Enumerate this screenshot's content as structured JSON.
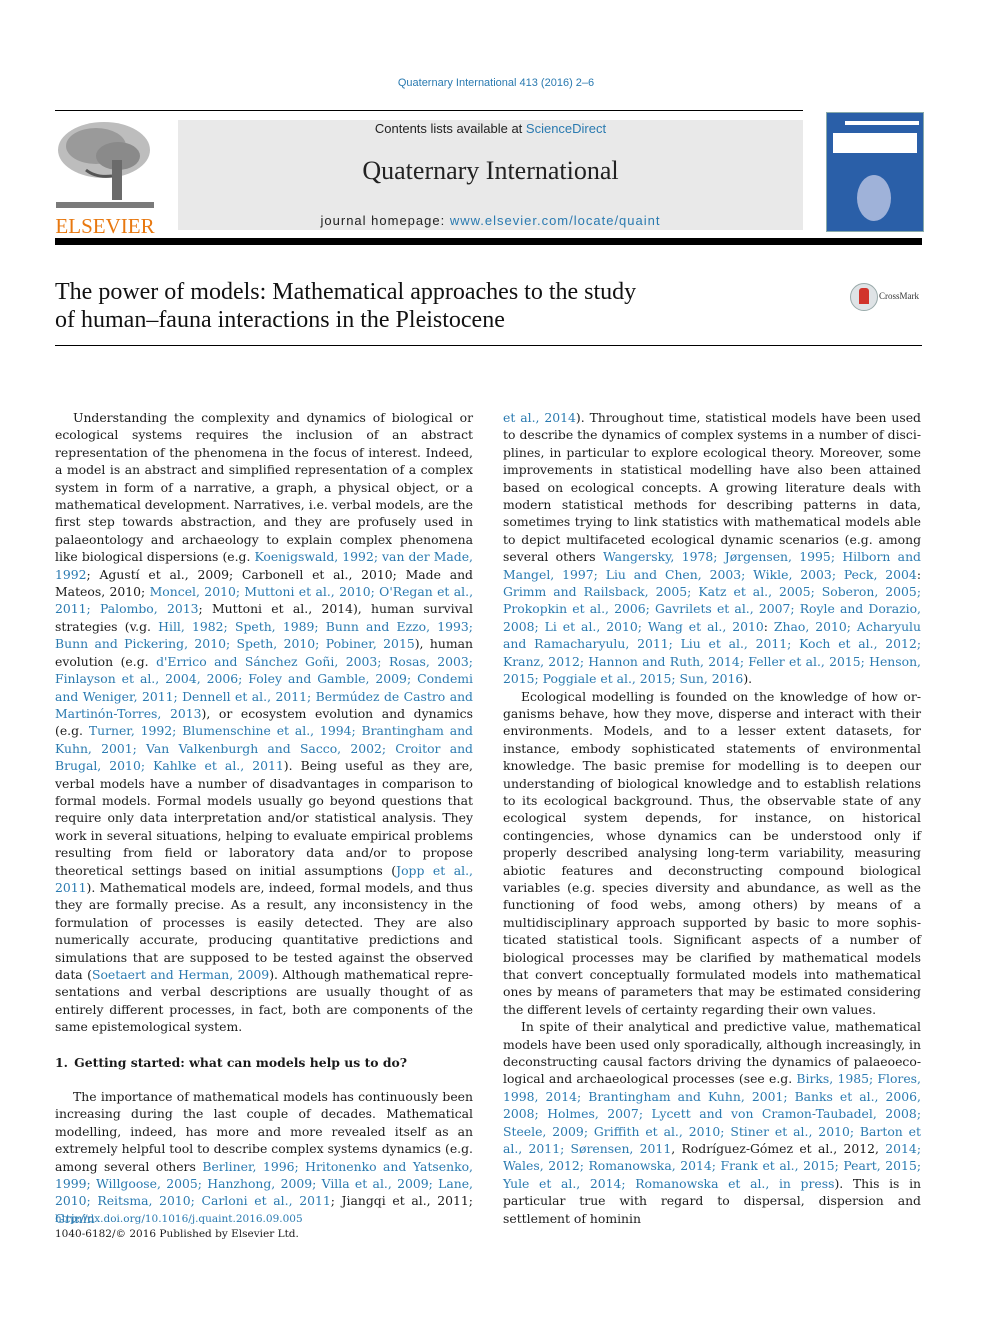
{
  "header": {
    "journal_reference": "Quaternary International 413 (2016) 2–6",
    "contents_prefix": "Contents lists available at ",
    "contents_link": "ScienceDirect",
    "journal_title": "Quaternary International",
    "homepage_prefix": "journal homepage: ",
    "homepage_link": "www.elsevier.com/locate/quaint",
    "publisher_logo_text": "ELSEVIER",
    "crossmark_label": "CrossMark"
  },
  "colors": {
    "link": "#2a7ab0",
    "elsevier_orange": "#e8780f",
    "masthead_bg": "#e9e9e9",
    "cover_blue": "#2a5fa8"
  },
  "article": {
    "title_line1": "The power of models: Mathematical approaches to the study",
    "title_line2": "of human–fauna interactions in the Pleistocene"
  },
  "left_column": {
    "p1": [
      {
        "t": "Understanding the complexity and dynamics of biological or ecological systems requires the inclusion of an abstract representa­tion of the phenomena in the focus of interest. Indeed, a model is an abstract and simplified representation of a complex system in form of a narrative, a graph, a physical object, or a mathematical devel­opment. Narratives, i.e. verbal models, are the first step towards abstraction, and they are profusely used in palaeontology and archaeology to explain complex phenomena like biological disper­sions (e.g. "
      },
      {
        "t": "Koenigswald, 1992; van der Made, 1992",
        "link": true
      },
      {
        "t": "; Agustí et al., 2009; Carbonell et al., 2010; Made and Mateos, 2010; "
      },
      {
        "t": "Moncel, 2010; Muttoni et al., 2010; O'Regan et al., 2011; Palombo, 2013",
        "link": true
      },
      {
        "t": "; Muttoni et al., 2014), human survival strategies (v.g. "
      },
      {
        "t": "Hill, 1982; Speth, 1989; Bunn and Ezzo, 1993; Bunn and Pickering, 2010; Speth, 2010; Pobiner, 2015",
        "link": true
      },
      {
        "t": "), human evolution (e.g. "
      },
      {
        "t": "d'Errico and Sánchez Goñi, 2003; Rosas, 2003; Finlayson et al., 2004, 2006; Foley and Gamble, 2009; Condemi and Weniger, 2011; Dennell et al., 2011; Bermúdez de Castro and Martinón-Torres, 2013",
        "link": true
      },
      {
        "t": "), or ecosystem evolution and dynamics (e.g. "
      },
      {
        "t": "Turner, 1992; Blumenschine et al., 1994; Brantingham and Kuhn, 2001; Van Valkenburgh and Sacco, 2002; Croitor and Brugal, 2010; Kahlke et al., 2011",
        "link": true
      },
      {
        "t": "). Being useful as they are, verbal models have a number of disadvantages in comparison to formal models. Formal models usually go beyond questions that require only data interpretation and/or statistical analysis. They work in several situations, helping to evaluate empirical problems resulting from field or laboratory data and/or to propose theoretical settings based on initial assump­tions ("
      },
      {
        "t": "Jopp et al., 2011",
        "link": true
      },
      {
        "t": "). Mathematical models are, indeed, formal models, and thus they are formally precise. As a result, any incon­sistency in the formulation of processes is easily detected. They are also numerically accurate, producing quantitative predictions and simulations that are supposed to be tested against the observed data ("
      },
      {
        "t": "Soetaert and Herman, 2009",
        "link": true
      },
      {
        "t": "). Although mathematical repre­sentations and verbal descriptions are usually thought of as entirely different processes, in fact, both are components of the same epis­temological system."
      }
    ],
    "section_heading": "1. Getting started: what can models help us to do?",
    "p2": [
      {
        "t": "The importance of mathematical models has continuously been increasing during the last couple of decades. Mathematical model­ling, indeed, has more and more revealed itself as an extremely helpful tool to describe complex systems dynamics (e.g. among several others "
      },
      {
        "t": "Berliner, 1996; Hritonenko and Yatsenko, 1999; Willgoose, 2005; Hanzhong, 2009; Villa et al., 2009; Lane, 2010; Reitsma, 2010; Carloni et al., 2011",
        "link": true
      },
      {
        "t": "; Jiangqi et al., 2011; "
      },
      {
        "t": "Grinin",
        "link": true
      }
    ]
  },
  "right_column": {
    "p1": [
      {
        "t": "et al., 2014",
        "link": true
      },
      {
        "t": "). Throughout time, statistical models have been used to describe the dynamics of complex systems in a number of disci­plines, in particular to explore ecological theory. Moreover, some improvements in statistical modelling have also been attained based on ecological concepts. A growing literature deals with mod­ern statistical methods for describing patterns in data, sometimes trying to link statistics with mathematical models able to depict multifaceted ecological dynamic scenarios (e.g. among several others "
      },
      {
        "t": "Wangersky, 1978; Jørgensen, 1995; Hilborn and Mangel, 1997; Liu and Chen, 2003; Wikle, 2003; Peck, 2004",
        "link": true
      },
      {
        "t": ": "
      },
      {
        "t": "Grimm and Railsback, 2005; Katz et al., 2005; Soberon, 2005; Prokopkin et al., 2006; Gavrilets et al., 2007; Royle and Dorazio, 2008; Li et al., 2010; Wang et al., 2010",
        "link": true
      },
      {
        "t": ": "
      },
      {
        "t": "Zhao, 2010; Acharyulu and Ramacharyulu, 2011; Liu et al., 2011; Koch et al., 2012; Kranz, 2012; Hannon and Ruth, 2014; Feller et al., 2015; Henson, 2015; Poggiale et al., 2015; Sun, 2016",
        "link": true
      },
      {
        "t": ")."
      }
    ],
    "p2": [
      {
        "t": "Ecological modelling is founded on the knowledge of how or­ganisms behave, how they move, disperse and interact with their environments. Models, and to a lesser extent datasets, for instance, embody sophisticated statements of environmental knowledge. The basic premise for modelling is to deepen our understanding of biological knowledge and to establish relations to its ecological background. Thus, the observable state of any ecological system de­pends, for instance, on historical contingencies, whose dynamics can be understood only if properly described analysing long-term variability, measuring abiotic features and deconstructing com­pound biological variables (e.g. species diversity and abundance, as well as the functioning of food webs, among others) by means of a multidisciplinary approach supported by basic to more sophis­ticated statistical tools. Significant aspects of a number of biological processes may be clarified by mathematical models that convert conceptually formulated models into mathematical ones by means of parameters that may be estimated considering the different levels of certainty regarding their own values."
      }
    ],
    "p3": [
      {
        "t": "In spite of their analytical and predictive value, mathematical models have been used only sporadically, although increasingly, in deconstructing causal factors driving the dynamics of palaeoeco­logical and archaeological processes (see e.g. "
      },
      {
        "t": "Birks, 1985; Flores, 1998, 2014; Brantingham and Kuhn, 2001; Banks et al., 2006, 2008; Holmes, 2007; Lycett and von Cramon-Taubadel, 2008; Steele, 2009; Griffith et al., 2010; Stiner et al., 2010; Barton et al., 2011; Sørensen, 2011",
        "link": true
      },
      {
        "t": ", Rodríguez-Gómez et al., 2012, "
      },
      {
        "t": "2014; Wales, 2012; Romanowska, 2014; Frank et al., 2015; Peart, 2015; Yule et al., 2014; Romanowska et al., in press",
        "link": true
      },
      {
        "t": "). This is in particular true with regard to dispersal, dispersion and settlement of hominin"
      }
    ]
  },
  "footer": {
    "doi": "http://dx.doi.org/10.1016/j.quaint.2016.09.005",
    "copyright": "1040-6182/© 2016 Published by Elsevier Ltd."
  }
}
